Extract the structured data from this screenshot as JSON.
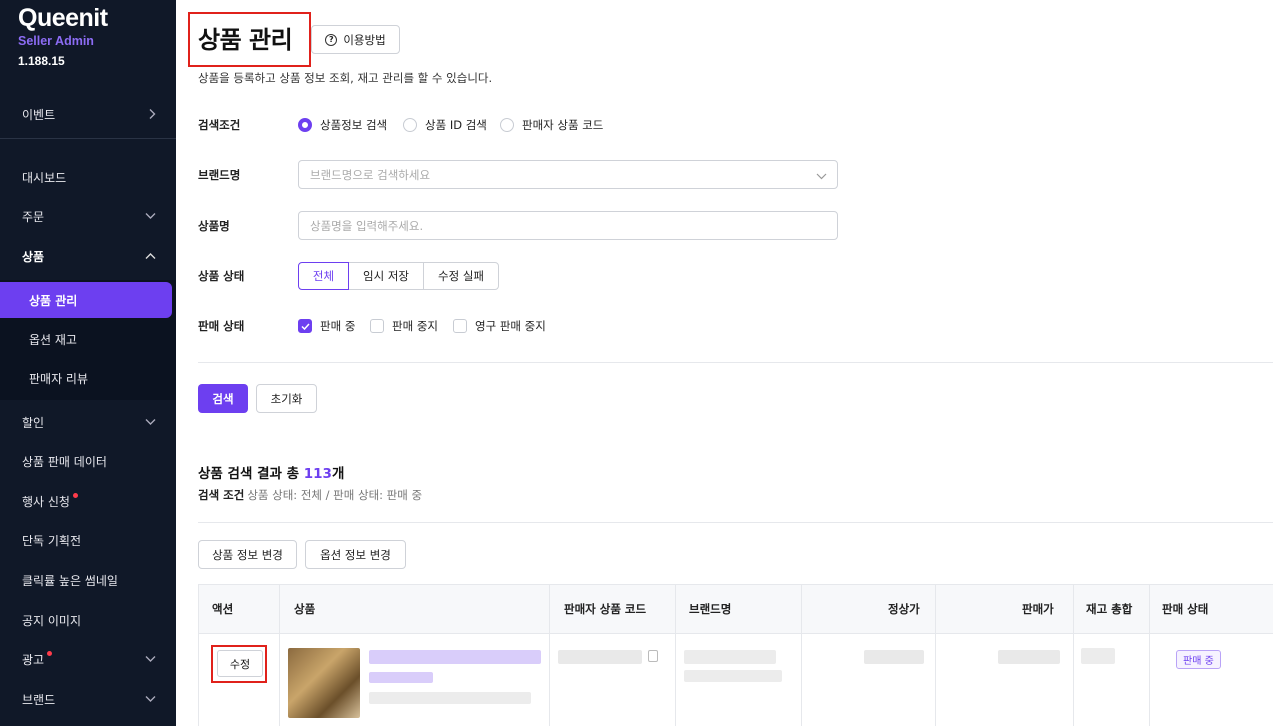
{
  "sidebar": {
    "brand": "Queenit",
    "subtitle": "Seller Admin",
    "version": "1.188.15",
    "items": {
      "event": "이벤트",
      "dashboard": "대시보드",
      "orders": "주문",
      "products": "상품",
      "product_manage": "상품 관리",
      "option_stock": "옵션 재고",
      "seller_review": "판매자 리뷰",
      "discount": "할인",
      "sales_data": "상품 판매 데이터",
      "event_apply": "행사 신청",
      "exclusive": "단독 기획전",
      "high_click_thumb": "클릭률 높은 썸네일",
      "notice_image": "공지 이미지",
      "ads": "광고",
      "brand": "브랜드"
    },
    "colors": {
      "bg": "#101828",
      "accent": "#6d3ff0",
      "new_dot": "#ff3b4a"
    }
  },
  "header": {
    "title": "상품 관리",
    "help_label": "이용방법",
    "description": "상품을 등록하고 상품 정보 조회, 재고 관리를 할 수 있습니다."
  },
  "filters": {
    "search_condition_label": "검색조건",
    "radio_options": [
      "상품정보 검색",
      "상품 ID 검색",
      "판매자 상품 코드"
    ],
    "radio_selected": "상품정보 검색",
    "brand_label": "브랜드명",
    "brand_placeholder": "브랜드명으로 검색하세요",
    "product_label": "상품명",
    "product_placeholder": "상품명을 입력해주세요.",
    "status_label": "상품 상태",
    "status_options": [
      "전체",
      "임시 저장",
      "수정 실패"
    ],
    "status_selected": "전체",
    "sale_label": "판매 상태",
    "sale_options": [
      "판매 중",
      "판매 중지",
      "영구 판매 중지"
    ],
    "sale_checked": [
      "판매 중"
    ],
    "search_button": "검색",
    "reset_button": "초기화"
  },
  "results": {
    "title_prefix": "상품 검색 결과 총 ",
    "count": "113",
    "title_suffix": "개",
    "condition_label": "검색 조건",
    "condition_value": "상품 상태: 전체 / 판매 상태: 판매 중",
    "bulk_edit_button": "상품 정보 변경",
    "option_edit_button": "옵션 정보 변경"
  },
  "table": {
    "columns": [
      "액션",
      "상품",
      "판매자 상품 코드",
      "브랜드명",
      "정상가",
      "판매가",
      "재고 총합",
      "판매 상태"
    ],
    "rows": [
      {
        "action": "수정",
        "status": "판매 중"
      }
    ]
  }
}
